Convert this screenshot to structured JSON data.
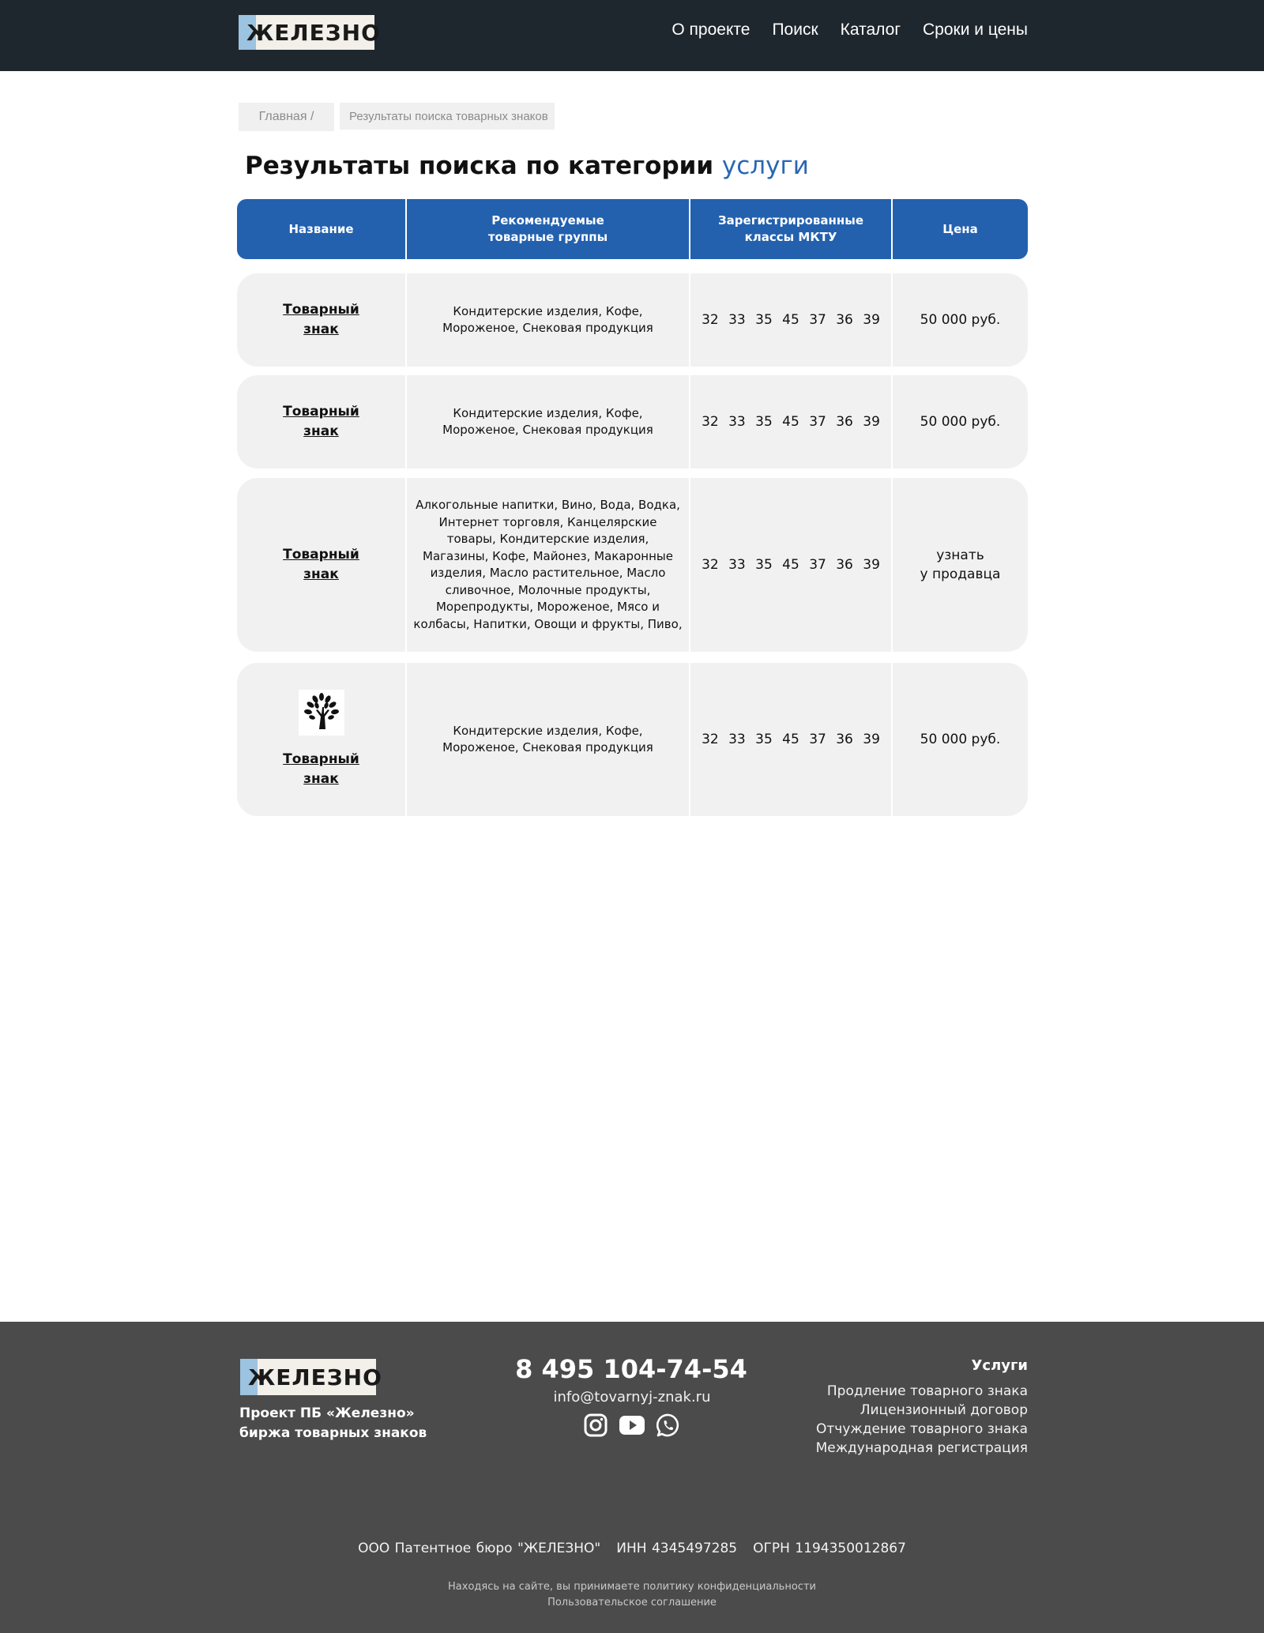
{
  "header": {
    "logo_text": "ЖЕЛЕЗНО",
    "nav": [
      "О проекте",
      "Поиск",
      "Каталог",
      "Сроки и цены"
    ]
  },
  "breadcrumb": {
    "home": "Главная /",
    "current": "Результаты поиска товарных знаков"
  },
  "page_title": {
    "prefix": "Результаты поиска по категории",
    "category": "услуги"
  },
  "table": {
    "headers": [
      "Название",
      "Рекомендуемые\nтоварные группы",
      "Зарегистрированные\nклассы МКТУ",
      "Цена"
    ],
    "rows": [
      {
        "name": "Товарный знак",
        "groups": "Кондитерские изделия, Кофе, Мороженое,  Снековая продукция",
        "classes": "32 33 35 45 37 36 39",
        "price": "50 000 руб."
      },
      {
        "name": "Товарный знак",
        "groups": "Кондитерские изделия, Кофе, Мороженое,  Снековая продукция",
        "classes": "32 33 35 45 37 36 39",
        "price": "50 000 руб."
      },
      {
        "name": "Товарный знак",
        "groups": "Алкогольные напитки, Вино, Вода, Водка,  Интернет торговля, Канцелярские товары, Кондитерские изделия, Магазины, Кофе, Майонез, Макаронные изделия, Масло растительное, Масло сливочное, Молочные продукты, Морепродукты, Мороженое, Мясо и колбасы, Напитки, Овощи и фрукты, Пиво,",
        "classes": "32 33 35 45 37 36 39",
        "price": "узнать\nу продавца"
      },
      {
        "name": "Товарный знак",
        "groups": "Кондитерские изделия, Кофе, Мороженое,  Снековая продукция",
        "classes": "32 33 35 45 37 36 39",
        "price": "50 000 руб.",
        "icon": "tree-logo-icon"
      }
    ]
  },
  "footer": {
    "logo_text": "ЖЕЛЕЗНО",
    "project_line1": "Проект ПБ «Железно»",
    "project_line2": "биржа товарных знаков",
    "phone": "8 495 104-74-54",
    "email": "info@tovarnyj-znak.ru",
    "socials": [
      "instagram-icon",
      "youtube-icon",
      "whatsapp-icon"
    ],
    "services_title": "Услуги",
    "services": [
      "Продление товарного знака",
      "Лицензионный договор",
      "Отчуждение товарного знака",
      "Международная регистрация"
    ],
    "company": "ООО Патентное бюро \"ЖЕЛЕЗНО\"",
    "inn": "ИНН 4345497285",
    "ogrn": "ОГРН 1194350012867",
    "privacy": "Находясь на сайте, вы принимаете политику конфиденциальности",
    "agreement": "Пользовательское соглашение"
  }
}
